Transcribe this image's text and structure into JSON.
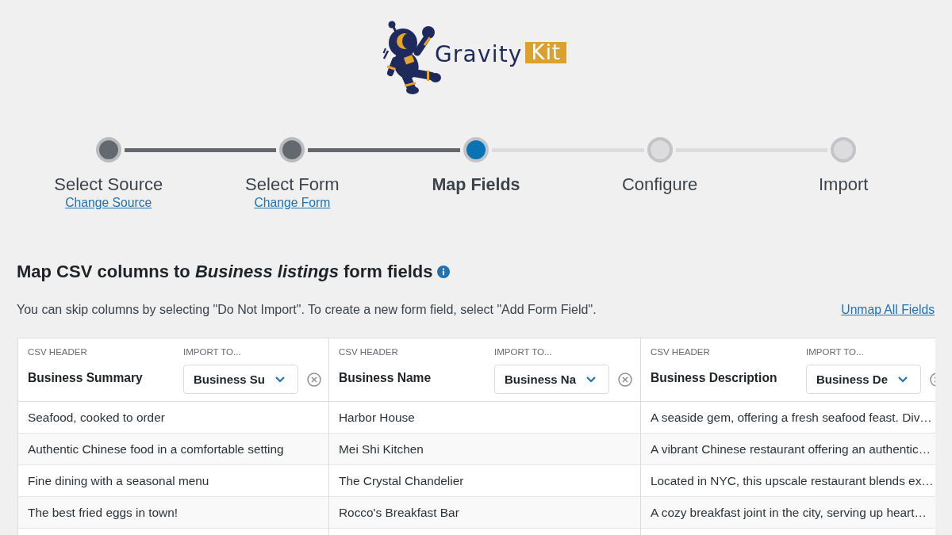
{
  "logo": {
    "text": "Gravity",
    "badge": "Kit"
  },
  "steps": [
    {
      "label": "Select Source",
      "link": "Change Source",
      "completed": true,
      "current": false
    },
    {
      "label": "Select Form",
      "link": "Change Form",
      "completed": true,
      "current": false
    },
    {
      "label": "Map Fields",
      "completed": false,
      "current": true
    },
    {
      "label": "Configure",
      "completed": false,
      "current": false
    },
    {
      "label": "Import",
      "completed": false,
      "current": false
    }
  ],
  "heading": "Map CSV columns to *Business listings* form fields",
  "description": "You can skip columns by selecting \"Do Not Import\". To create a new form field, select \"Add Form Field\".",
  "unmap_link": "Unmap All Fields",
  "table": {
    "columns": [
      {
        "header_label": "CSV HEADER",
        "header": "Business Summary",
        "import_label": "IMPORT TO...",
        "import_value": "Business Su"
      },
      {
        "header_label": "CSV HEADER",
        "header": "Business Name",
        "import_label": "IMPORT TO...",
        "import_value": "Business Na"
      },
      {
        "header_label": "CSV HEADER",
        "header": "Business Description",
        "import_label": "IMPORT TO...",
        "import_value": "Business De"
      }
    ],
    "rows": [
      [
        "Seafood, cooked to order",
        "Harbor House",
        "A seaside gem, offering a fresh seafood feast. Div…"
      ],
      [
        "Authentic Chinese food in a comfortable setting",
        "Mei Shi Kitchen",
        "A vibrant Chinese restaurant offering an authentic…"
      ],
      [
        "Fine dining with a seasonal menu",
        "The Crystal Chandelier",
        "Located in NYC, this upscale restaurant blends ex…"
      ],
      [
        "The best fried eggs in town!",
        "Rocco's Breakfast Bar",
        "A cozy breakfast joint in the city, serving up heart…"
      ]
    ]
  }
}
